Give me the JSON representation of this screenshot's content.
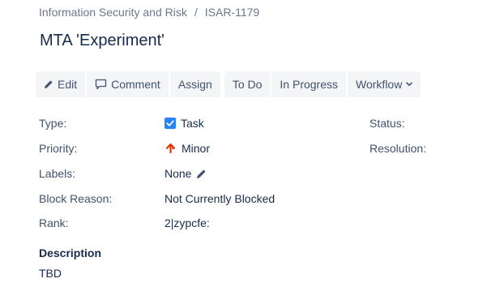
{
  "breadcrumb": {
    "project": "Information Security and Risk",
    "separator": "/",
    "issue_key": "ISAR-1179"
  },
  "issue": {
    "title": "MTA 'Experiment'"
  },
  "toolbar": {
    "edit": "Edit",
    "comment": "Comment",
    "assign": "Assign",
    "todo": "To Do",
    "in_progress": "In Progress",
    "workflow": "Workflow"
  },
  "details": {
    "type": {
      "label": "Type:",
      "value": "Task",
      "icon": "task-checkbox-icon"
    },
    "priority": {
      "label": "Priority:",
      "value": "Minor",
      "icon": "arrow-up-icon"
    },
    "labels": {
      "label": "Labels:",
      "value": "None",
      "icon": "pencil-icon"
    },
    "block_reason": {
      "label": "Block Reason:",
      "value": "Not Currently Blocked"
    },
    "rank": {
      "label": "Rank:",
      "value": "2|zypcfe:"
    },
    "status": {
      "label": "Status:"
    },
    "resolution": {
      "label": "Resolution:"
    }
  },
  "description": {
    "heading": "Description",
    "text": "TBD"
  },
  "colors": {
    "task_blue": "#2684ff",
    "priority_red": "#de350b",
    "button_bg": "#f4f5f7",
    "text": "#172b4d",
    "muted": "#6b778c"
  }
}
